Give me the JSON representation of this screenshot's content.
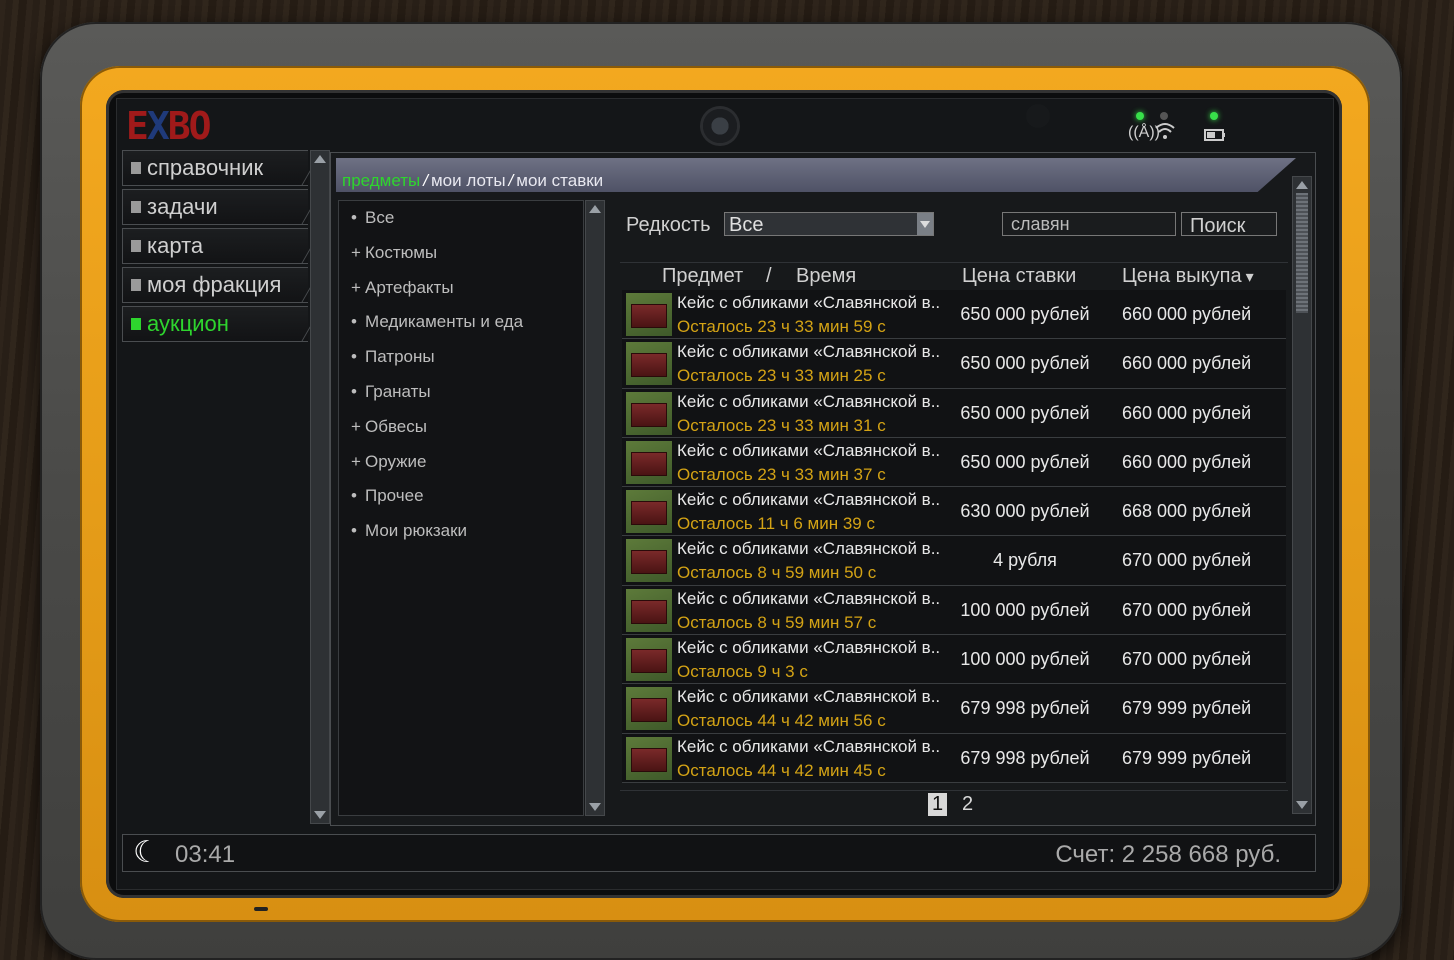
{
  "logo": {
    "text_a": "E",
    "text_b": "X",
    "text_c": "BO"
  },
  "nav": [
    {
      "label": "справочник",
      "active": false
    },
    {
      "label": "задачи",
      "active": false
    },
    {
      "label": "карта",
      "active": false
    },
    {
      "label": "моя фракция",
      "active": false
    },
    {
      "label": "аукцион",
      "active": true
    }
  ],
  "breadcrumb": {
    "items": [
      "предметы",
      "мои лоты",
      "мои ставки"
    ],
    "active": "предметы",
    "separator": "/"
  },
  "categories": [
    {
      "marker": "•",
      "label": "Все"
    },
    {
      "marker": "+",
      "label": "Костюмы"
    },
    {
      "marker": "+",
      "label": "Артефакты"
    },
    {
      "marker": "•",
      "label": "Медикаменты и еда"
    },
    {
      "marker": "•",
      "label": "Патроны"
    },
    {
      "marker": "•",
      "label": "Гранаты"
    },
    {
      "marker": "+",
      "label": "Обвесы"
    },
    {
      "marker": "+",
      "label": "Оружие"
    },
    {
      "marker": "•",
      "label": "Прочее"
    },
    {
      "marker": "•",
      "label": "Мои рюкзаки"
    }
  ],
  "filter": {
    "rarity_label": "Редкость",
    "rarity_value": "Все",
    "search_value": "славян",
    "search_button": "Поиск"
  },
  "table": {
    "col_item": "Предмет",
    "col_sep": "/",
    "col_time": "Время",
    "col_bid": "Цена ставки",
    "col_buyout": "Цена выкупа",
    "sort_indicator": "▾",
    "rows": [
      {
        "name": "Кейс с обликами «Славянской в..",
        "time": "Осталось 23 ч 33 мин 59 с",
        "bid": "650 000 рублей",
        "buyout": "660 000 рублей"
      },
      {
        "name": "Кейс с обликами «Славянской в..",
        "time": "Осталось 23 ч 33 мин 25 с",
        "bid": "650 000 рублей",
        "buyout": "660 000 рублей"
      },
      {
        "name": "Кейс с обликами «Славянской в..",
        "time": "Осталось 23 ч 33 мин 31 с",
        "bid": "650 000 рублей",
        "buyout": "660 000 рублей"
      },
      {
        "name": "Кейс с обликами «Славянской в..",
        "time": "Осталось 23 ч 33 мин 37 с",
        "bid": "650 000 рублей",
        "buyout": "660 000 рублей"
      },
      {
        "name": "Кейс с обликами «Славянской в..",
        "time": "Осталось 11 ч 6 мин 39 с",
        "bid": "630 000 рублей",
        "buyout": "668 000 рублей"
      },
      {
        "name": "Кейс с обликами «Славянской в..",
        "time": "Осталось 8 ч 59 мин 50 с",
        "bid": "4 рубля",
        "buyout": "670 000 рублей"
      },
      {
        "name": "Кейс с обликами «Славянской в..",
        "time": "Осталось 8 ч 59 мин 57 с",
        "bid": "100 000 рублей",
        "buyout": "670 000 рублей"
      },
      {
        "name": "Кейс с обликами «Славянской в..",
        "time": "Осталось 9 ч 3 с",
        "bid": "100 000 рублей",
        "buyout": "670 000 рублей"
      },
      {
        "name": "Кейс с обликами «Славянской в..",
        "time": "Осталось 44 ч 42 мин 56 с",
        "bid": "679 998 рублей",
        "buyout": "679 999 рублей"
      },
      {
        "name": "Кейс с обликами «Славянской в..",
        "time": "Осталось 44 ч 42 мин 45 с",
        "bid": "679 998 рублей",
        "buyout": "679 999 рублей"
      }
    ]
  },
  "pager": {
    "pages": [
      "1",
      "2"
    ],
    "current": "1"
  },
  "footer": {
    "clock": "03:41",
    "balance": "Счет: 2 258 668 руб."
  },
  "colors": {
    "accent_green": "#2ed52e",
    "timer_gold": "#d4a315",
    "rim_orange": "#f3a81f"
  },
  "icons": {
    "moon": "moon-icon",
    "signal": "signal-icon",
    "wifi": "wifi-icon",
    "battery": "battery-icon"
  }
}
